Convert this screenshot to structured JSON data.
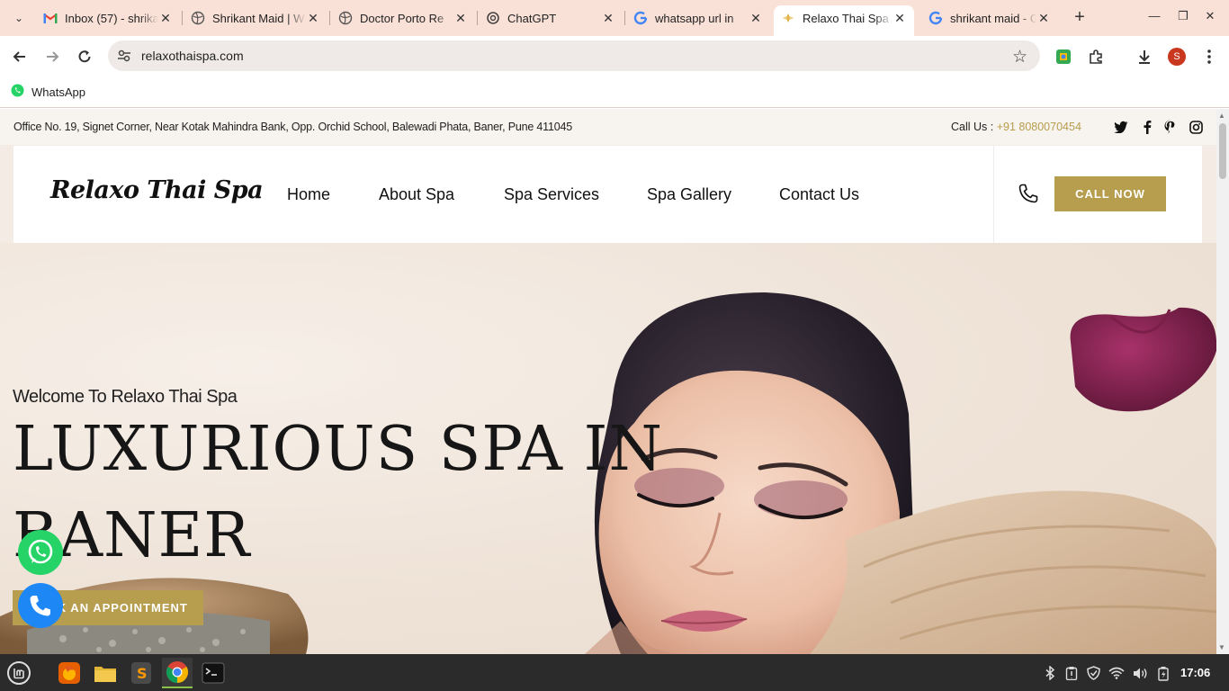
{
  "browser": {
    "tabs": [
      {
        "title": "Inbox (57) - shrikant",
        "icon": "gmail-icon"
      },
      {
        "title": "Shrikant Maid | W",
        "icon": "globe-icon"
      },
      {
        "title": "Doctor Porto Re",
        "icon": "globe-icon"
      },
      {
        "title": "ChatGPT",
        "icon": "chatgpt-icon"
      },
      {
        "title": "whatsapp url in",
        "icon": "google-icon"
      },
      {
        "title": "Relaxo Thai Spa",
        "icon": "spa-icon",
        "active": true
      },
      {
        "title": "shrikant maid - G",
        "icon": "google-icon"
      }
    ],
    "url": "relaxothaispa.com",
    "profile_initial": "S",
    "bookmarks": [
      {
        "label": "WhatsApp",
        "icon": "whatsapp-icon"
      }
    ]
  },
  "site": {
    "topbar": {
      "address": "Office No. 19, Signet Corner, Near Kotak Mahindra Bank, Opp. Orchid School, Balewadi Phata, Baner, Pune 411045",
      "call_label": "Call Us : ",
      "call_number": "+91 8080070454",
      "social": [
        "twitter-icon",
        "facebook-icon",
        "pinterest-icon",
        "instagram-icon"
      ]
    },
    "logo": "Relaxo Thai Spa",
    "nav": [
      "Home",
      "About Spa",
      "Spa Services",
      "Spa Gallery",
      "Contact Us"
    ],
    "cta": "CALL NOW",
    "hero": {
      "welcome": "Welcome To Relaxo Thai Spa",
      "headline_line1": "LUXURIOUS SPA IN",
      "headline_line2": "BANER",
      "button": "BOOK AN APPOINTMENT"
    }
  },
  "taskbar": {
    "apps": [
      "menu-icon",
      "firefox-icon",
      "files-icon",
      "sublime-icon",
      "chrome-icon",
      "terminal-icon"
    ],
    "clock": "17:06"
  },
  "colors": {
    "accent": "#b79d4e",
    "tabbar": "#fae1d8",
    "whatsapp": "#25d366",
    "call": "#1d87f5"
  }
}
